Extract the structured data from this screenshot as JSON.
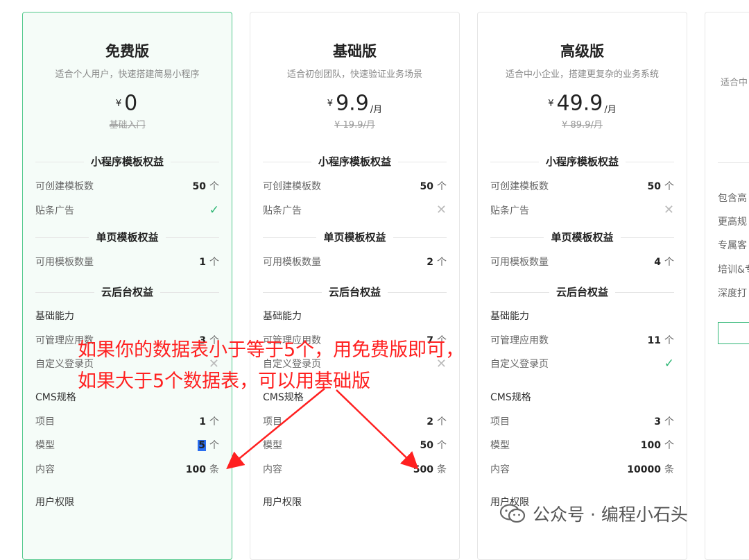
{
  "plans": [
    {
      "title": "免费版",
      "subtitle": "适合个人用户，快速搭建简易小程序",
      "currency": "¥",
      "amount": "0",
      "unit": "",
      "original": "基础入门",
      "mini_section": "小程序模板权益",
      "templates_label": "可创建模板数",
      "templates_value": "50",
      "templates_unit": "个",
      "ads_label": "贴条广告",
      "ads": "yes",
      "single_section": "单页模板权益",
      "single_label": "可用模板数量",
      "single_value": "1",
      "single_unit": "个",
      "cloud_section": "云后台权益",
      "basic_label": "基础能力",
      "apps_label": "可管理应用数",
      "apps_value": "3",
      "apps_unit": "个",
      "login_label": "自定义登录页",
      "login": "no",
      "cms_label": "CMS规格",
      "proj_label": "项目",
      "proj_value": "1",
      "proj_unit": "个",
      "model_label": "模型",
      "model_value": "5",
      "model_unit": "个",
      "content_label": "内容",
      "content_value": "100",
      "content_unit": "条",
      "perm_label": "用户权限"
    },
    {
      "title": "基础版",
      "subtitle": "适合初创团队，快速验证业务场景",
      "currency": "¥",
      "amount": "9.9",
      "unit": "/月",
      "original": "¥ 19.9/月",
      "mini_section": "小程序模板权益",
      "templates_label": "可创建模板数",
      "templates_value": "50",
      "templates_unit": "个",
      "ads_label": "贴条广告",
      "ads": "no",
      "single_section": "单页模板权益",
      "single_label": "可用模板数量",
      "single_value": "2",
      "single_unit": "个",
      "cloud_section": "云后台权益",
      "basic_label": "基础能力",
      "apps_label": "可管理应用数",
      "apps_value": "7",
      "apps_unit": "个",
      "login_label": "自定义登录页",
      "login": "no",
      "cms_label": "CMS规格",
      "proj_label": "项目",
      "proj_value": "2",
      "proj_unit": "个",
      "model_label": "模型",
      "model_value": "50",
      "model_unit": "个",
      "content_label": "内容",
      "content_value": "500",
      "content_unit": "条",
      "perm_label": "用户权限"
    },
    {
      "title": "高级版",
      "subtitle": "适合中小企业，搭建更复杂的业务系统",
      "currency": "¥",
      "amount": "49.9",
      "unit": "/月",
      "original": "¥ 89.9/月",
      "mini_section": "小程序模板权益",
      "templates_label": "可创建模板数",
      "templates_value": "50",
      "templates_unit": "个",
      "ads_label": "贴条广告",
      "ads": "no",
      "single_section": "单页模板权益",
      "single_label": "可用模板数量",
      "single_value": "4",
      "single_unit": "个",
      "cloud_section": "云后台权益",
      "basic_label": "基础能力",
      "apps_label": "可管理应用数",
      "apps_value": "11",
      "apps_unit": "个",
      "login_label": "自定义登录页",
      "login": "yes",
      "cms_label": "CMS规格",
      "proj_label": "项目",
      "proj_value": "3",
      "proj_unit": "个",
      "model_label": "模型",
      "model_value": "100",
      "model_unit": "个",
      "content_label": "内容",
      "content_value": "10000",
      "content_unit": "条",
      "perm_label": "用户权限"
    }
  ],
  "card4": {
    "subtitle": "适合中",
    "items": [
      "包含高",
      "更高规",
      "专属客",
      "培训&专",
      "深度打"
    ]
  },
  "annotation": {
    "line1": "如果你的数据表小于等于5个，用免费版即可，",
    "line2": "如果大于5个数据表，可以用基础版"
  },
  "watermark": {
    "text": "公众号 · 编程小石头"
  },
  "colors": {
    "accent": "#2cb573",
    "annotation": "#ff2020",
    "highlight": "#2a6ef0"
  }
}
